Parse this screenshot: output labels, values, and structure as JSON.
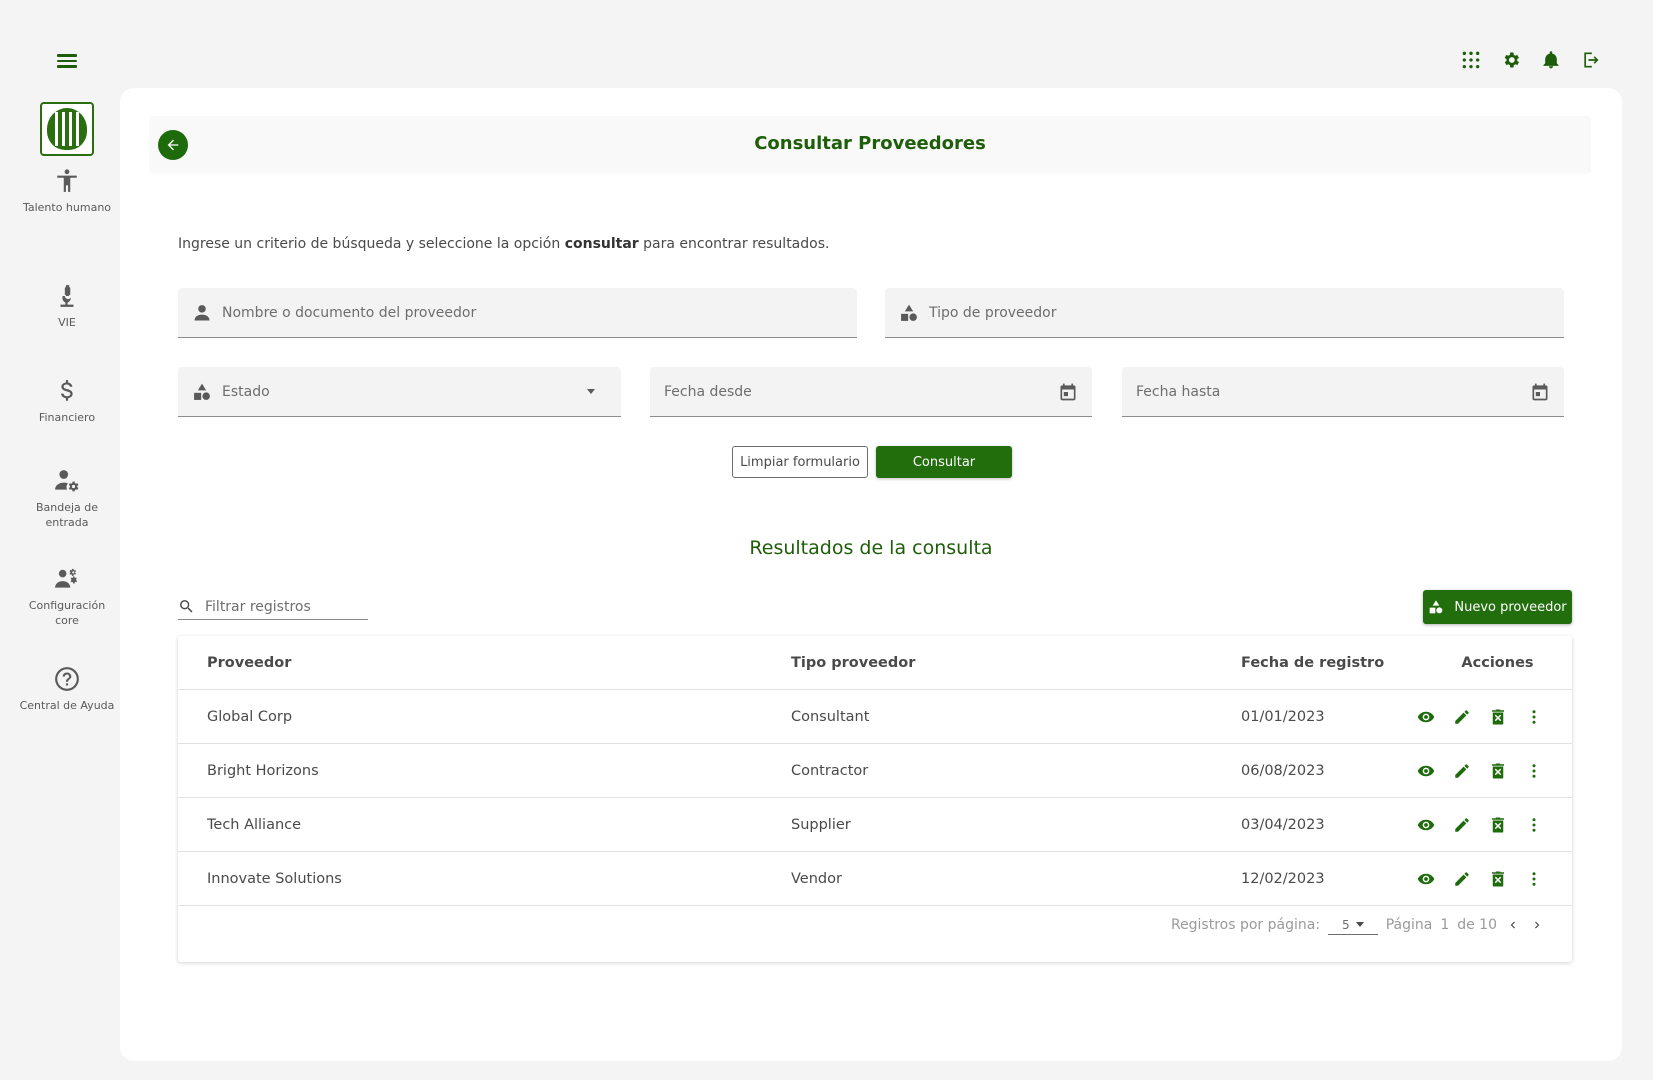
{
  "page": {
    "title": "Consultar Proveedores"
  },
  "sidebar": {
    "items": [
      {
        "label": "Talento humano",
        "icon": "accessibility-icon"
      },
      {
        "label": "VIE",
        "icon": "microscope-icon"
      },
      {
        "label": "Financiero",
        "icon": "dollar-icon"
      },
      {
        "label": "Bandeja de entrada",
        "icon": "user-gear-icon"
      },
      {
        "label": "Configuración core",
        "icon": "users-gear-icon"
      },
      {
        "label": "Central de Ayuda",
        "icon": "help-icon"
      }
    ]
  },
  "form": {
    "instructions_pre": "Ingrese un criterio de búsqueda y seleccione la opción ",
    "instructions_bold": "consultar",
    "instructions_post": " para encontrar resultados.",
    "provider_placeholder": "Nombre o documento del proveedor",
    "type_placeholder": "Tipo de proveedor",
    "status_placeholder": "Estado",
    "date_from_placeholder": "Fecha desde",
    "date_to_placeholder": "Fecha hasta",
    "clear_label": "Limpiar formulario",
    "submit_label": "Consultar"
  },
  "results": {
    "title": "Resultados de la consulta",
    "filter_placeholder": "Filtrar registros",
    "new_label": "Nuevo proveedor",
    "columns": [
      "Proveedor",
      "Tipo proveedor",
      "Fecha de registro",
      "Acciones"
    ],
    "rows": [
      {
        "provider": "Global Corp",
        "type": "Consultant",
        "date": "01/01/2023"
      },
      {
        "provider": "Bright Horizons",
        "type": "Contractor",
        "date": "06/08/2023"
      },
      {
        "provider": "Tech Alliance",
        "type": "Supplier",
        "date": "03/04/2023"
      },
      {
        "provider": "Innovate Solutions",
        "type": "Vendor",
        "date": "12/02/2023"
      }
    ],
    "pagination": {
      "per_page_label": "Registros por página:",
      "per_page_value": "5",
      "page_label": "Página",
      "page_current": "1",
      "page_of": "de 10"
    }
  },
  "colors": {
    "primary": "#226e0c",
    "title": "#1e5e0a"
  }
}
